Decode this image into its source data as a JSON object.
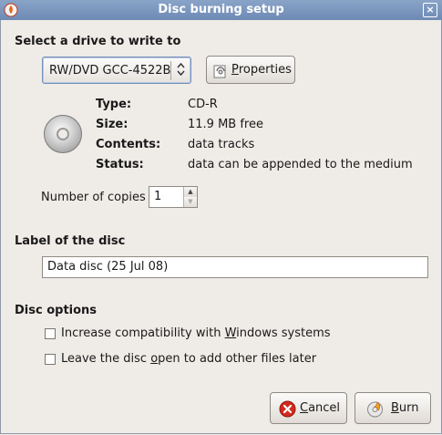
{
  "window": {
    "title": "Disc burning setup",
    "close_glyph": "×"
  },
  "drive": {
    "heading": "Select a drive to write to",
    "selected": "RW/DVD GCC-4522B",
    "properties_pre": "",
    "properties_u": "P",
    "properties_post": "roperties"
  },
  "disc_info": {
    "type_label": "Type:",
    "type_value": "CD-R",
    "size_label": "Size:",
    "size_value": "11.9 MB free",
    "contents_label": "Contents:",
    "contents_value": "data tracks",
    "status_label": "Status:",
    "status_value": "data can be appended to the medium"
  },
  "copies": {
    "label": "Number of copies",
    "value": "1"
  },
  "label_section": {
    "heading": "Label of the disc",
    "value": "Data disc (25 Jul 08)"
  },
  "options": {
    "heading": "Disc options",
    "opt1_pre": "Increase compatibility with ",
    "opt1_u": "W",
    "opt1_post": "indows systems",
    "opt1_checked": false,
    "opt2_pre": "Leave the disc ",
    "opt2_u": "o",
    "opt2_post": "pen to add other files later",
    "opt2_checked": false
  },
  "buttons": {
    "cancel_u": "C",
    "cancel_post": "ancel",
    "burn_u": "B",
    "burn_post": "urn"
  },
  "icons": {
    "app": "brasero-app-icon",
    "disc": "cd-disc-icon",
    "properties": "properties-icon",
    "cancel": "cancel-icon",
    "burn": "burn-icon"
  },
  "colors": {
    "titlebar": "#7a94bd",
    "cancel_icon": "#d42a1e",
    "burn_icon": "#f0a020"
  }
}
